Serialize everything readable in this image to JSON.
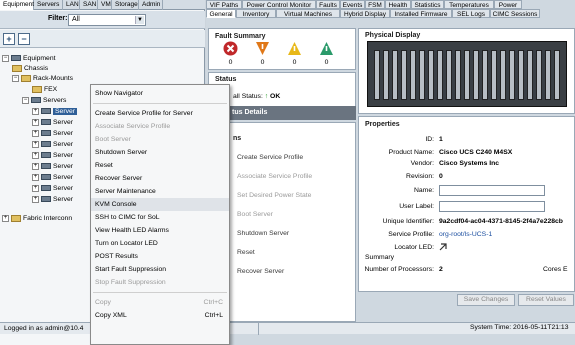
{
  "nav_tabs": [
    "Equipment",
    "Servers",
    "LAN",
    "SAN",
    "VM",
    "Storage",
    "Admin"
  ],
  "filter": {
    "label": "Filter:",
    "value": "All"
  },
  "toolbar": {
    "expand": "+",
    "collapse": "−"
  },
  "tree": {
    "equipment": "Equipment",
    "chassis": "Chassis",
    "rack_mounts": "Rack-Mounts",
    "fex": "FEX",
    "servers": "Servers",
    "server_items": [
      "Server",
      "Server",
      "Server",
      "Server",
      "Server",
      "Server",
      "Server",
      "Server",
      "Server"
    ],
    "fabric": "Fabric Interconn"
  },
  "left_status": "Logged in as admin@10.4",
  "top_tabs_row1": [
    "VIF Paths",
    "Power Control Monitor",
    "Faults",
    "Events",
    "FSM",
    "Health",
    "Statistics",
    "Temperatures",
    "Power"
  ],
  "top_tabs_row2": [
    "General",
    "Inventory",
    "Virtual Machines",
    "Hybrid Display",
    "Installed Firmware",
    "SEL Logs",
    "CIMC Sessions"
  ],
  "fault_summary": {
    "title": "Fault Summary",
    "counts": [
      "0",
      "0",
      "0",
      "0"
    ]
  },
  "status": {
    "title": "Status",
    "overall": "all Status:",
    "ok": "OK",
    "details": "tus Details"
  },
  "actions": {
    "title": "ns",
    "items": [
      "Create Service Profile",
      "Associate Service Profile",
      "Set Desired Power State",
      "Boot Server",
      "Shutdown Server",
      "Reset",
      "Recover Server"
    ]
  },
  "physical_display": {
    "title": "Physical Display"
  },
  "properties": {
    "title": "Properties",
    "id_label": "ID:",
    "id": "1",
    "product_label": "Product Name:",
    "product": "Cisco UCS C240 M4SX",
    "vendor_label": "Vendor:",
    "vendor": "Cisco Systems Inc",
    "revision_label": "Revision:",
    "revision": "0",
    "name_label": "Name:",
    "user_label_label": "User Label:",
    "uid_label": "Unique Identifier:",
    "uid": "9a2cdf04-ac04-4371-8145-2f4a7e228cb",
    "sp_label": "Service Profile:",
    "sp": "org-root/ls-UCS-1",
    "locator_label": "Locator LED:",
    "summary_label": "Summary",
    "processors_label": "Number of Processors:",
    "processors": "2",
    "cores_label": "Cores E"
  },
  "buttons": {
    "save": "Save Changes",
    "reset": "Reset Values"
  },
  "system_time": "System Time: 2016-05-11T21:13",
  "context_menu": [
    {
      "label": "Show Navigator",
      "disabled": false
    },
    {
      "sep": true
    },
    {
      "label": "Create Service Profile for Server",
      "disabled": false
    },
    {
      "label": "Associate Service Profile",
      "disabled": true
    },
    {
      "label": "Boot Server",
      "disabled": true
    },
    {
      "label": "Shutdown Server",
      "disabled": false
    },
    {
      "label": "Reset",
      "disabled": false
    },
    {
      "label": "Recover Server",
      "disabled": false
    },
    {
      "label": "Server Maintenance",
      "disabled": false
    },
    {
      "label": "KVM Console",
      "disabled": false,
      "highlight": true
    },
    {
      "label": "SSH to CIMC for SoL",
      "disabled": false
    },
    {
      "label": "View Health LED Alarms",
      "disabled": false
    },
    {
      "label": "Turn on Locator LED",
      "disabled": false
    },
    {
      "label": "POST Results",
      "disabled": false
    },
    {
      "label": "Start Fault Suppression",
      "disabled": false
    },
    {
      "label": "Stop Fault Suppression",
      "disabled": true
    },
    {
      "sep": true
    },
    {
      "label": "Copy",
      "shortcut": "Ctrl+C",
      "disabled": true
    },
    {
      "label": "Copy XML",
      "shortcut": "Ctrl+L",
      "disabled": false
    }
  ],
  "colors": {
    "selection": "#2f5f98",
    "link": "#1c4fa0",
    "fault_critical": "#c0282a",
    "fault_major": "#e07818",
    "fault_minor": "#e8b818",
    "fault_warning": "#2a9a6a"
  }
}
